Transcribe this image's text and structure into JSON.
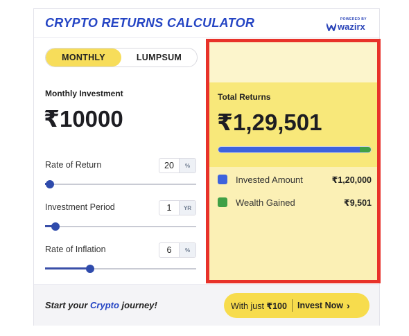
{
  "header": {
    "title": "CRYPTO RETURNS CALCULATOR",
    "powered_by": "POWERED BY",
    "brand": "wazirx"
  },
  "mode_toggle": {
    "options": [
      "MONTHLY",
      "LUMPSUM"
    ],
    "selected": "MONTHLY"
  },
  "investment": {
    "label": "Monthly Investment",
    "value": "₹10000"
  },
  "fields": [
    {
      "label": "Rate of Return",
      "value": "20",
      "unit": "%",
      "slider_fraction": 0.03
    },
    {
      "label": "Investment Period",
      "value": "1",
      "unit": "YR",
      "slider_fraction": 0.07
    },
    {
      "label": "Rate of Inflation",
      "value": "6",
      "unit": "%",
      "slider_fraction": 0.3
    }
  ],
  "results": {
    "label": "Total Returns",
    "value": "₹1,29,501",
    "breakdown": [
      {
        "label": "Invested Amount",
        "value": "₹1,20,000",
        "color": "#3e63dd",
        "share": 0.927
      },
      {
        "label": "Wealth Gained",
        "value": "₹9,501",
        "color": "#3fa046",
        "share": 0.073
      }
    ]
  },
  "footer": {
    "tagline_pre": "Start your ",
    "tagline_highlight": "Crypto",
    "tagline_post": " journey!",
    "cta_pre": "With just ",
    "cta_amount": "₹100",
    "cta_action": "Invest Now",
    "cta_icon": "chevron-right-icon"
  },
  "colors": {
    "accent_blue": "#2545c4",
    "highlight_yellow": "#f7dd5a",
    "selection_border": "#e8322a"
  }
}
